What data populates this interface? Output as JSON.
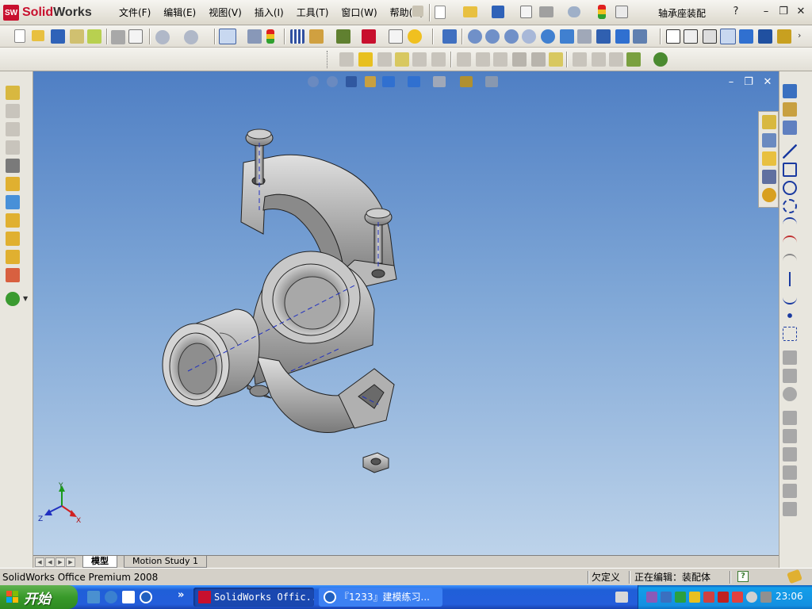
{
  "app": {
    "name_prefix": "Solid",
    "name_suffix": "Works",
    "badge": "SW",
    "document_title": "轴承座装配"
  },
  "menu": [
    "文件(F)",
    "编辑(E)",
    "视图(V)",
    "插入(I)",
    "工具(T)",
    "窗口(W)",
    "帮助(H)"
  ],
  "title_controls": {
    "help": "?",
    "minimize": "–",
    "restore": "❐",
    "close": "✕"
  },
  "viewport_controls": {
    "minimize": "–",
    "restore": "❐",
    "close": "✕"
  },
  "triad": {
    "x": "X",
    "y": "Y",
    "z": "Z"
  },
  "tabs": {
    "model": "模型",
    "motion_study": "Motion Study 1"
  },
  "status": {
    "product": "SolidWorks Office Premium 2008",
    "definition": "欠定义",
    "editing": "正在编辑：装配体",
    "help_icon": "?"
  },
  "taskbar": {
    "start": "开始",
    "tasks": [
      "SolidWorks Offic...",
      "『1233』建模练习..."
    ],
    "more": "»",
    "clock": "23:06"
  },
  "colors": {
    "viewport_top": "#4f7fc4",
    "viewport_bottom": "#bdd3ea",
    "brand_red": "#c8102e",
    "taskbar_blue": "#245edb",
    "start_green": "#389a2a"
  }
}
